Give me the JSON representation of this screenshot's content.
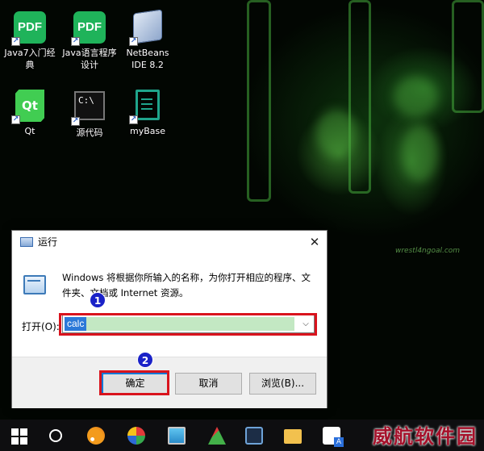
{
  "desktop": {
    "icons": [
      {
        "label": "Java7入门经典",
        "glyph_text": "PDF"
      },
      {
        "label": "Java语言程序设计",
        "glyph_text": "PDF"
      },
      {
        "label": "NetBeans IDE 8.2",
        "glyph_text": ""
      },
      {
        "label": "Qt",
        "glyph_text": "Qt"
      },
      {
        "label": "源代码",
        "glyph_text": "C:\\"
      },
      {
        "label": "myBase",
        "glyph_text": ""
      }
    ],
    "wallpaper_text": "wrestl4ngoal.com"
  },
  "run_dialog": {
    "title": "运行",
    "description": "Windows 将根据你所输入的名称，为你打开相应的程序、文件夹、文档或 Internet 资源。",
    "open_label": "打开(O):",
    "command_value": "calc",
    "ok_label": "确定",
    "cancel_label": "取消",
    "browse_label": "浏览(B)..."
  },
  "annotations": {
    "marker_1": "1",
    "marker_2": "2",
    "highlight_color": "#d9131d",
    "marker_color": "#1a22c8"
  },
  "taskbar": {
    "watermark": "威航软件园"
  },
  "colors": {
    "dialog_focus": "#0078d7",
    "selection": "#2b79d8"
  }
}
